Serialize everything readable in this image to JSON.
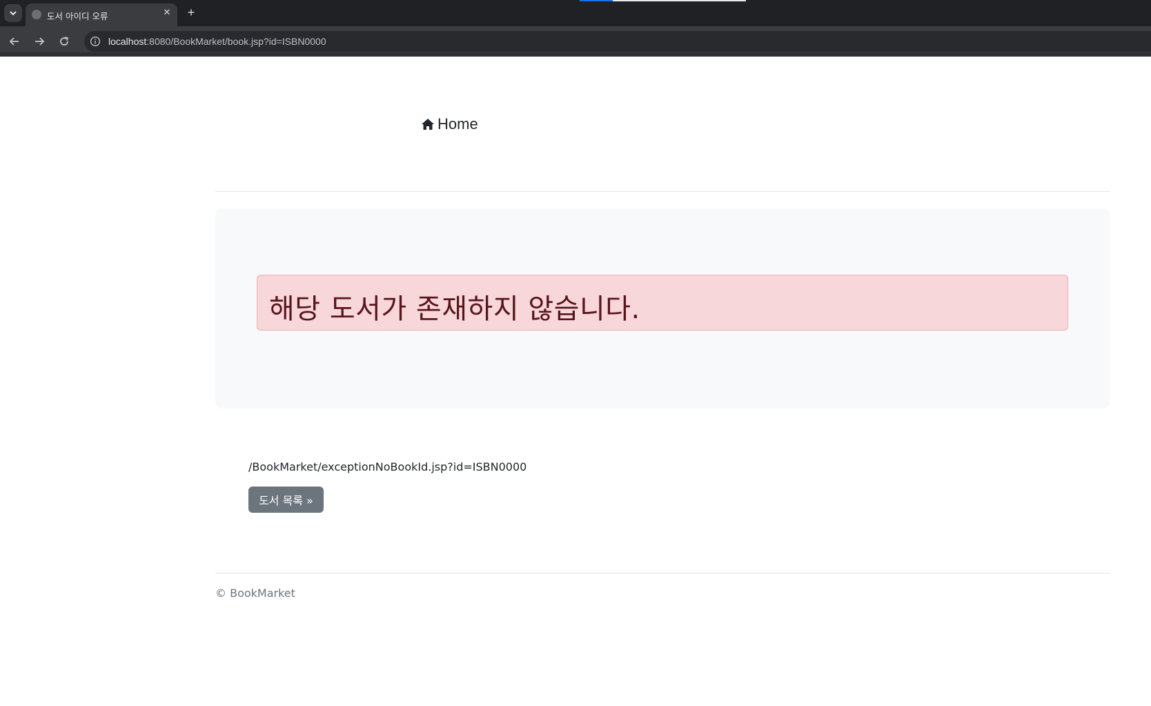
{
  "browser": {
    "tab_title": "도서 아이디 오류",
    "tab_close": "✕",
    "new_tab": "+",
    "url_host": "localhost",
    "url_rest": ":8080/BookMarket/book.jsp?id=ISBN0000",
    "icons": {
      "back": "arrow-left-icon",
      "forward": "arrow-right-icon",
      "reload": "reload-icon",
      "info": "info-icon",
      "tab_search": "chevron-down-icon"
    }
  },
  "nav": {
    "home_label": "Home",
    "home_icon": "house-icon"
  },
  "alert": {
    "message": "해당 도서가 존재하지 않습니다.",
    "color": "#f8d7da",
    "text_color": "#58151c"
  },
  "content": {
    "request_uri": "/BookMarket/exceptionNoBookId.jsp?id=ISBN0000",
    "list_button": "도서 목록 »"
  },
  "footer": {
    "text": "© BookMarket"
  }
}
